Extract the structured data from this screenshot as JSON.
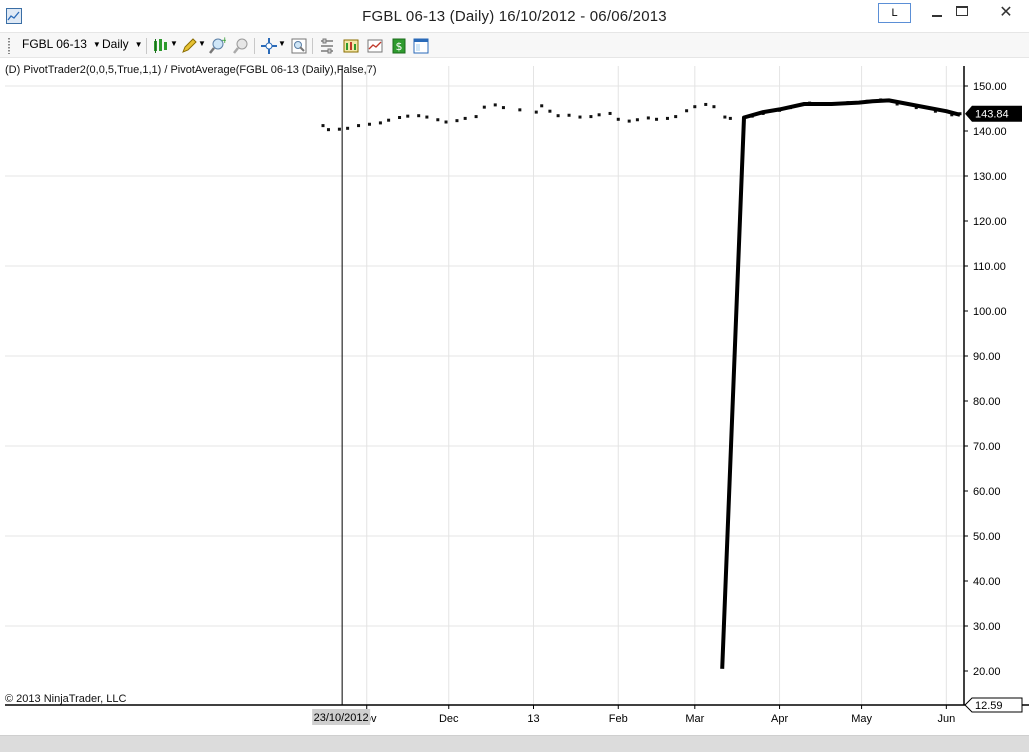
{
  "window": {
    "title": "FGBL 06-13 (Daily)  16/10/2012 - 06/06/2013",
    "layout_button": "L",
    "close_symbol": "✕"
  },
  "toolbar": {
    "instrument": "FGBL 06-13",
    "interval": "Daily",
    "icons": [
      "chart-style-icon",
      "drawing-tool-icon",
      "zoom-in-icon",
      "zoom-out-icon",
      "crosshair-icon",
      "data-box-icon",
      "properties-icon",
      "strategies-icon",
      "indicators-icon",
      "orders-icon",
      "templates-icon"
    ]
  },
  "chart": {
    "indicator_label": "(D) PivotTrader2(0,0,5,True,1,1) / PivotAverage(FGBL 06-13 (Daily),False,7)",
    "copyright": "© 2013 NinjaTrader, LLC",
    "price_badge": "143.84",
    "crosshair_value": "12.59",
    "crosshair_date": "23/10/2012"
  },
  "chart_data": {
    "type": "line",
    "y_ticks": [
      20,
      30,
      40,
      50,
      60,
      70,
      80,
      90,
      100,
      110,
      120,
      130,
      140,
      150
    ],
    "y_tick_labels": [
      "20.00",
      "30.00",
      "40.00",
      "50.00",
      "60.00",
      "70.00",
      "80.00",
      "90.00",
      "100.00",
      "110.00",
      "120.00",
      "130.00",
      "140.00",
      "150.00"
    ],
    "ylim": [
      12.59,
      153.5
    ],
    "x_labels": [
      "Nov",
      "Dec",
      "13",
      "Feb",
      "Mar",
      "Apr",
      "May",
      "Jun"
    ],
    "x_label_dates": [
      "2012-11-01",
      "2012-12-01",
      "2013-01-01",
      "2013-02-01",
      "2013-03-01",
      "2013-04-01",
      "2013-05-01",
      "2013-06-01"
    ],
    "xlim": [
      "2012-10-16",
      "2013-06-06"
    ],
    "crosshair_x": "2012-10-23",
    "series": [
      {
        "values": [
          [
            "2012-10-16",
            141.2
          ],
          [
            "2012-10-18",
            140.3
          ],
          [
            "2012-10-22",
            140.4
          ],
          [
            "2012-10-25",
            140.6
          ],
          [
            "2012-10-29",
            141.2
          ],
          [
            "2012-11-02",
            141.5
          ],
          [
            "2012-11-06",
            141.8
          ],
          [
            "2012-11-09",
            142.4
          ],
          [
            "2012-11-13",
            143.0
          ],
          [
            "2012-11-16",
            143.3
          ],
          [
            "2012-11-20",
            143.4
          ],
          [
            "2012-11-23",
            143.1
          ],
          [
            "2012-11-27",
            142.5
          ],
          [
            "2012-11-30",
            142.0
          ],
          [
            "2012-12-04",
            142.3
          ],
          [
            "2012-12-07",
            142.8
          ],
          [
            "2012-12-11",
            143.2
          ],
          [
            "2012-12-14",
            145.3
          ],
          [
            "2012-12-18",
            145.8
          ],
          [
            "2012-12-21",
            145.2
          ],
          [
            "2012-12-27",
            144.7
          ],
          [
            "2013-01-02",
            144.2
          ],
          [
            "2013-01-04",
            145.6
          ],
          [
            "2013-01-07",
            144.4
          ],
          [
            "2013-01-10",
            143.4
          ],
          [
            "2013-01-14",
            143.5
          ],
          [
            "2013-01-18",
            143.1
          ],
          [
            "2013-01-22",
            143.2
          ],
          [
            "2013-01-25",
            143.6
          ],
          [
            "2013-01-29",
            143.9
          ],
          [
            "2013-02-01",
            142.6
          ],
          [
            "2013-02-05",
            142.2
          ],
          [
            "2013-02-08",
            142.5
          ],
          [
            "2013-02-12",
            142.9
          ],
          [
            "2013-02-15",
            142.6
          ],
          [
            "2013-02-19",
            142.8
          ],
          [
            "2013-02-22",
            143.2
          ],
          [
            "2013-02-26",
            144.5
          ],
          [
            "2013-03-01",
            145.4
          ],
          [
            "2013-03-05",
            145.9
          ],
          [
            "2013-03-08",
            145.4
          ],
          [
            "2013-03-12",
            143.1
          ],
          [
            "2013-03-14",
            142.8
          ],
          [
            "2013-03-19",
            143.0
          ],
          [
            "2013-03-22",
            143.3
          ],
          [
            "2013-03-26",
            143.9
          ],
          [
            "2013-04-01",
            144.6
          ],
          [
            "2013-04-05",
            145.2
          ],
          [
            "2013-04-12",
            146.2
          ],
          [
            "2013-04-19",
            146.0
          ],
          [
            "2013-04-26",
            146.3
          ],
          [
            "2013-05-03",
            146.6
          ],
          [
            "2013-05-08",
            146.9
          ],
          [
            "2013-05-14",
            146.0
          ],
          [
            "2013-05-21",
            145.2
          ],
          [
            "2013-05-28",
            144.4
          ],
          [
            "2013-06-03",
            143.6
          ],
          [
            "2013-06-06",
            143.84
          ]
        ]
      },
      {
        "values": [
          [
            "2013-03-11",
            20.5
          ],
          [
            "2013-03-19",
            143.0
          ],
          [
            "2013-03-26",
            144.2
          ],
          [
            "2013-04-01",
            144.8
          ],
          [
            "2013-04-10",
            146.0
          ],
          [
            "2013-04-20",
            146.0
          ],
          [
            "2013-04-30",
            146.3
          ],
          [
            "2013-05-05",
            146.6
          ],
          [
            "2013-05-11",
            146.8
          ],
          [
            "2013-05-18",
            146.0
          ],
          [
            "2013-05-25",
            145.2
          ],
          [
            "2013-06-01",
            144.4
          ],
          [
            "2013-06-06",
            143.6
          ]
        ]
      }
    ]
  }
}
